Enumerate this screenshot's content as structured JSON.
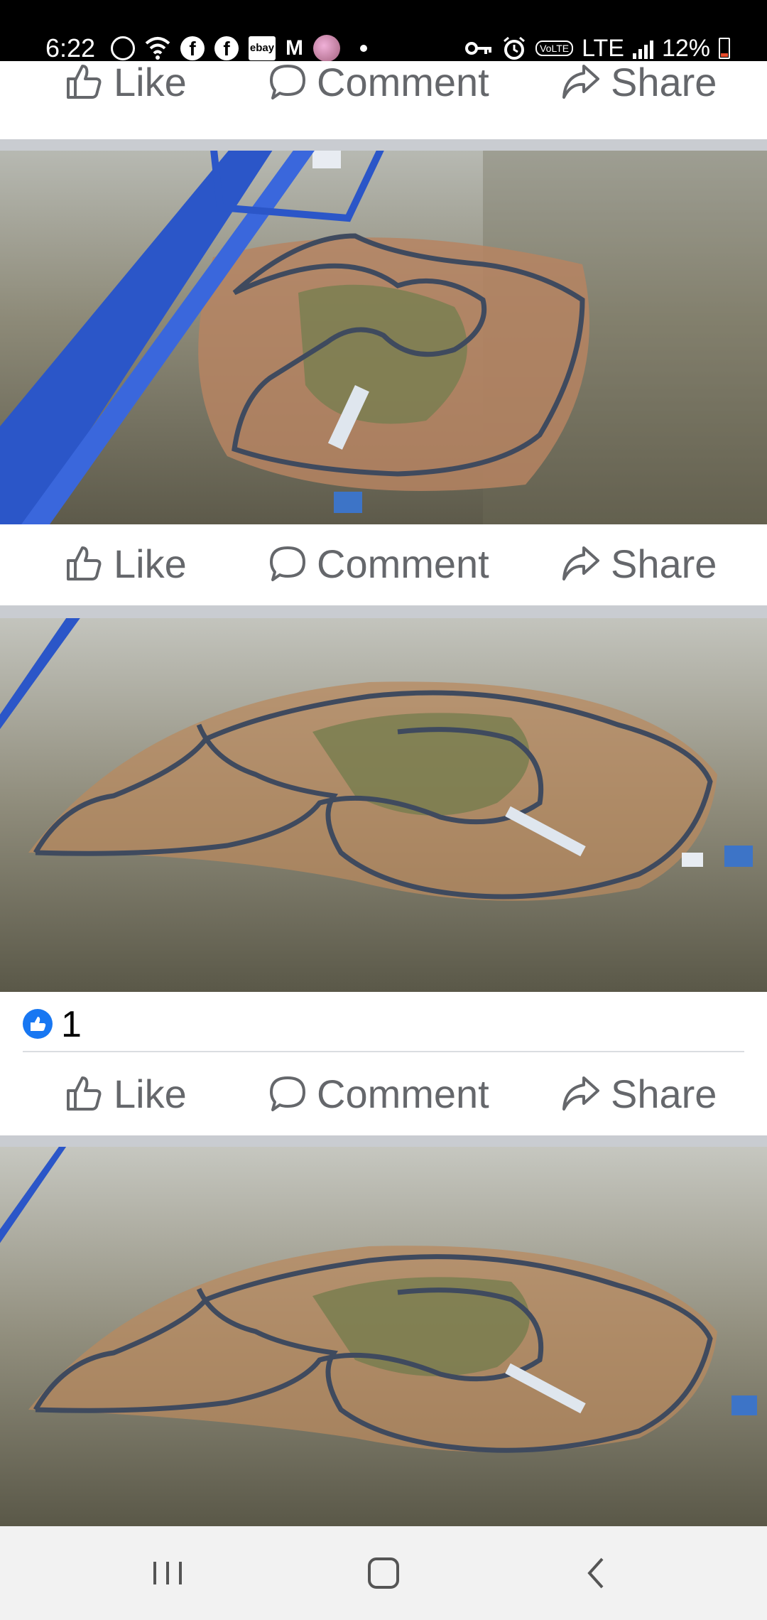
{
  "status_bar": {
    "time": "6:22",
    "network": "LTE",
    "volte_badge": "VoLTE",
    "battery_percent": "12%",
    "battery_level": 0.12,
    "notification_icons": [
      "settings-sync-icon",
      "wifi-calling-icon",
      "facebook-icon",
      "facebook-icon",
      "ebay-icon",
      "gmail-icon",
      "avatar-icon",
      "more-dot-icon"
    ],
    "system_icons": [
      "vpn-key-icon",
      "alarm-icon",
      "volte-icon",
      "signal-icon",
      "battery-icon"
    ]
  },
  "feed": {
    "actions": {
      "like": "Like",
      "comment": "Comment",
      "share": "Share"
    },
    "posts": [
      {
        "photo": "aerial-race-track-photo-1"
      },
      {
        "photo": "aerial-race-track-photo-2"
      },
      {
        "photo": "aerial-race-track-photo-3",
        "reaction_count": "1"
      }
    ]
  },
  "colors": {
    "action_text": "#65676b",
    "separator": "#c9ccd1",
    "like_blue": "#1877f2",
    "statusbar_bg": "#000000",
    "navbar_bg": "#f2f2f2"
  },
  "navigation": {
    "buttons": [
      "recent-apps-icon",
      "home-icon",
      "back-icon"
    ]
  }
}
